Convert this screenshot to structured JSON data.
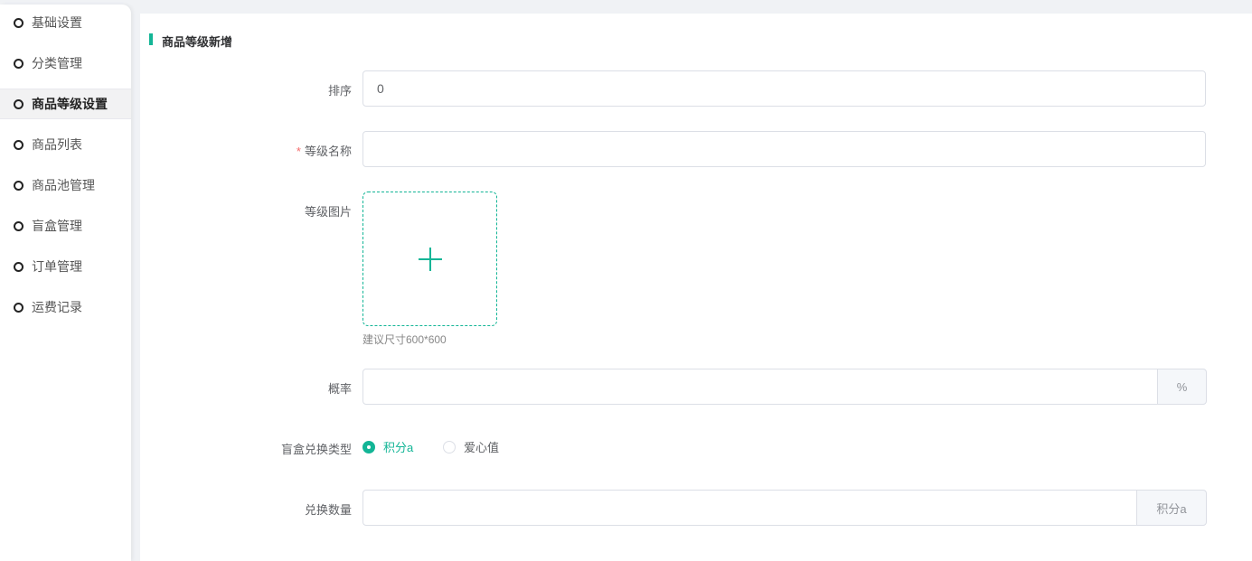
{
  "sidebar": {
    "items": [
      {
        "label": "基础设置"
      },
      {
        "label": "分类管理"
      },
      {
        "label": "商品等级设置",
        "active": true
      },
      {
        "label": "商品列表"
      },
      {
        "label": "商品池管理"
      },
      {
        "label": "盲盒管理"
      },
      {
        "label": "订单管理"
      },
      {
        "label": "运费记录"
      }
    ]
  },
  "form": {
    "title": "商品等级新增",
    "sort": {
      "label": "排序",
      "value": "0"
    },
    "name": {
      "required_mark": "*",
      "label": "等级名称",
      "value": ""
    },
    "image": {
      "label": "等级图片",
      "hint": "建议尺寸600*600"
    },
    "probability": {
      "label": "概率",
      "value": "",
      "append": "%"
    },
    "exchange_type": {
      "label": "盲盒兑换类型",
      "options": [
        {
          "label": "积分a",
          "checked": true
        },
        {
          "label": "爱心值",
          "checked": false
        }
      ]
    },
    "exchange_amount": {
      "label": "兑换数量",
      "value": "",
      "append": "积分a"
    }
  },
  "colors": {
    "accent": "#13b596"
  }
}
